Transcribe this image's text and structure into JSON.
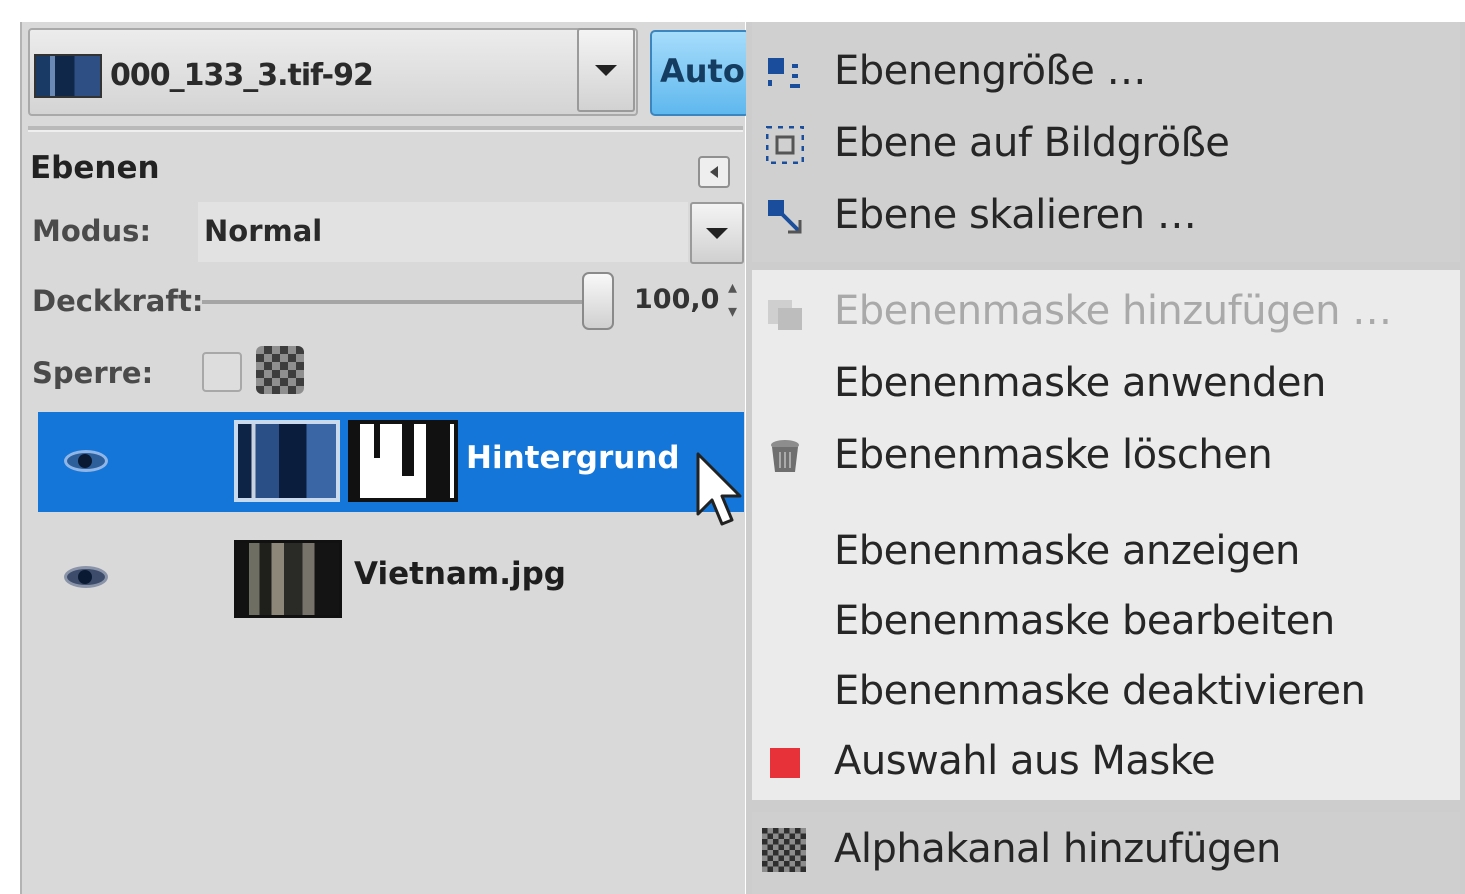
{
  "layers_dock": {
    "image_selector": {
      "name": "000_133_3.tif-92"
    },
    "auto_button": "Auto",
    "panel_title": "Ebenen",
    "mode": {
      "label": "Modus:",
      "value": "Normal"
    },
    "opacity": {
      "label": "Deckkraft:",
      "value": "100,0",
      "level": 1.0
    },
    "lock": {
      "label": "Sperre:"
    },
    "layers": [
      {
        "name": "Hintergrund",
        "selected": true,
        "has_mask": true,
        "visible": true
      },
      {
        "name": "Vietnam.jpg",
        "selected": false,
        "has_mask": false,
        "visible": true
      }
    ]
  },
  "context_menu": {
    "items": [
      {
        "label": "Ebenengröße …",
        "icon": "layer-size-icon",
        "enabled": true
      },
      {
        "label": "Ebene auf Bildgröße",
        "icon": "layer-to-image-size-icon",
        "enabled": true
      },
      {
        "label": "Ebene skalieren …",
        "icon": "scale-layer-icon",
        "enabled": true
      },
      {
        "label": "Ebenenmaske hinzufügen …",
        "icon": "add-layer-mask-icon",
        "enabled": false
      },
      {
        "label": "Ebenenmaske anwenden",
        "icon": "",
        "enabled": true
      },
      {
        "label": "Ebenenmaske löschen",
        "icon": "delete-icon",
        "enabled": true
      },
      {
        "label": "Ebenenmaske anzeigen",
        "icon": "",
        "enabled": true
      },
      {
        "label": "Ebenenmaske bearbeiten",
        "icon": "",
        "enabled": true
      },
      {
        "label": "Ebenenmaske deaktivieren",
        "icon": "",
        "enabled": true
      },
      {
        "label": "Auswahl aus Maske",
        "icon": "mask-to-selection-icon",
        "enabled": true
      },
      {
        "label": "Alphakanal hinzufügen",
        "icon": "alpha-channel-icon",
        "enabled": true
      }
    ]
  },
  "colors": {
    "selection_blue": "#1476d8",
    "auto_button": "#5fb8ee",
    "menu_red_icon": "#e8323a"
  }
}
